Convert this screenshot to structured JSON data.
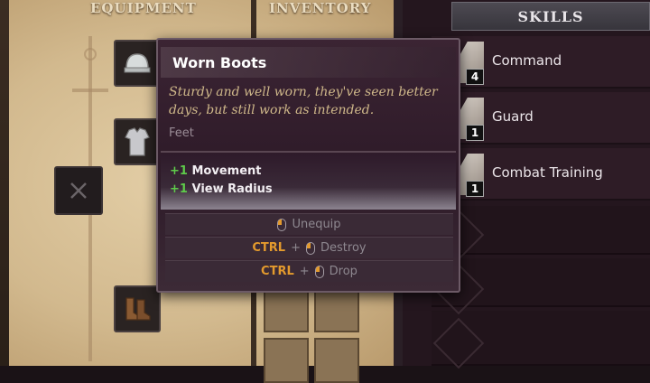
{
  "equipment_panel": {
    "header_equipment": "EQUIPMENT",
    "header_inventory": "INVENTORY",
    "slots": [
      {
        "name": "head-slot",
        "icon": "helmet-icon"
      },
      {
        "name": "body-slot",
        "icon": "armor-icon"
      },
      {
        "name": "weapon-slot",
        "icon": "crossed-swords-icon"
      },
      {
        "name": "feet-slot",
        "icon": "boots-icon"
      }
    ]
  },
  "skills": {
    "tab_label": "SKILLS",
    "items": [
      {
        "label": "Command",
        "level": "4"
      },
      {
        "label": "Guard",
        "level": "1"
      },
      {
        "label": "Combat Training",
        "level": "1"
      }
    ]
  },
  "tooltip": {
    "title": "Worn Boots",
    "description": "Sturdy and well worn, they've seen better days, but still work as intended.",
    "type": "Feet",
    "stats": [
      {
        "value": "+1",
        "label": "Movement"
      },
      {
        "value": "+1",
        "label": "View Radius"
      }
    ],
    "actions": [
      {
        "key": "",
        "label": "Unequip"
      },
      {
        "key": "CTRL",
        "label": "Destroy"
      },
      {
        "key": "CTRL",
        "label": "Drop"
      }
    ],
    "plus_symbol": "+"
  },
  "colors": {
    "accent_orange": "#e39a2d",
    "stat_green": "#5ecb4a",
    "desc_gold": "#cfb88a"
  }
}
